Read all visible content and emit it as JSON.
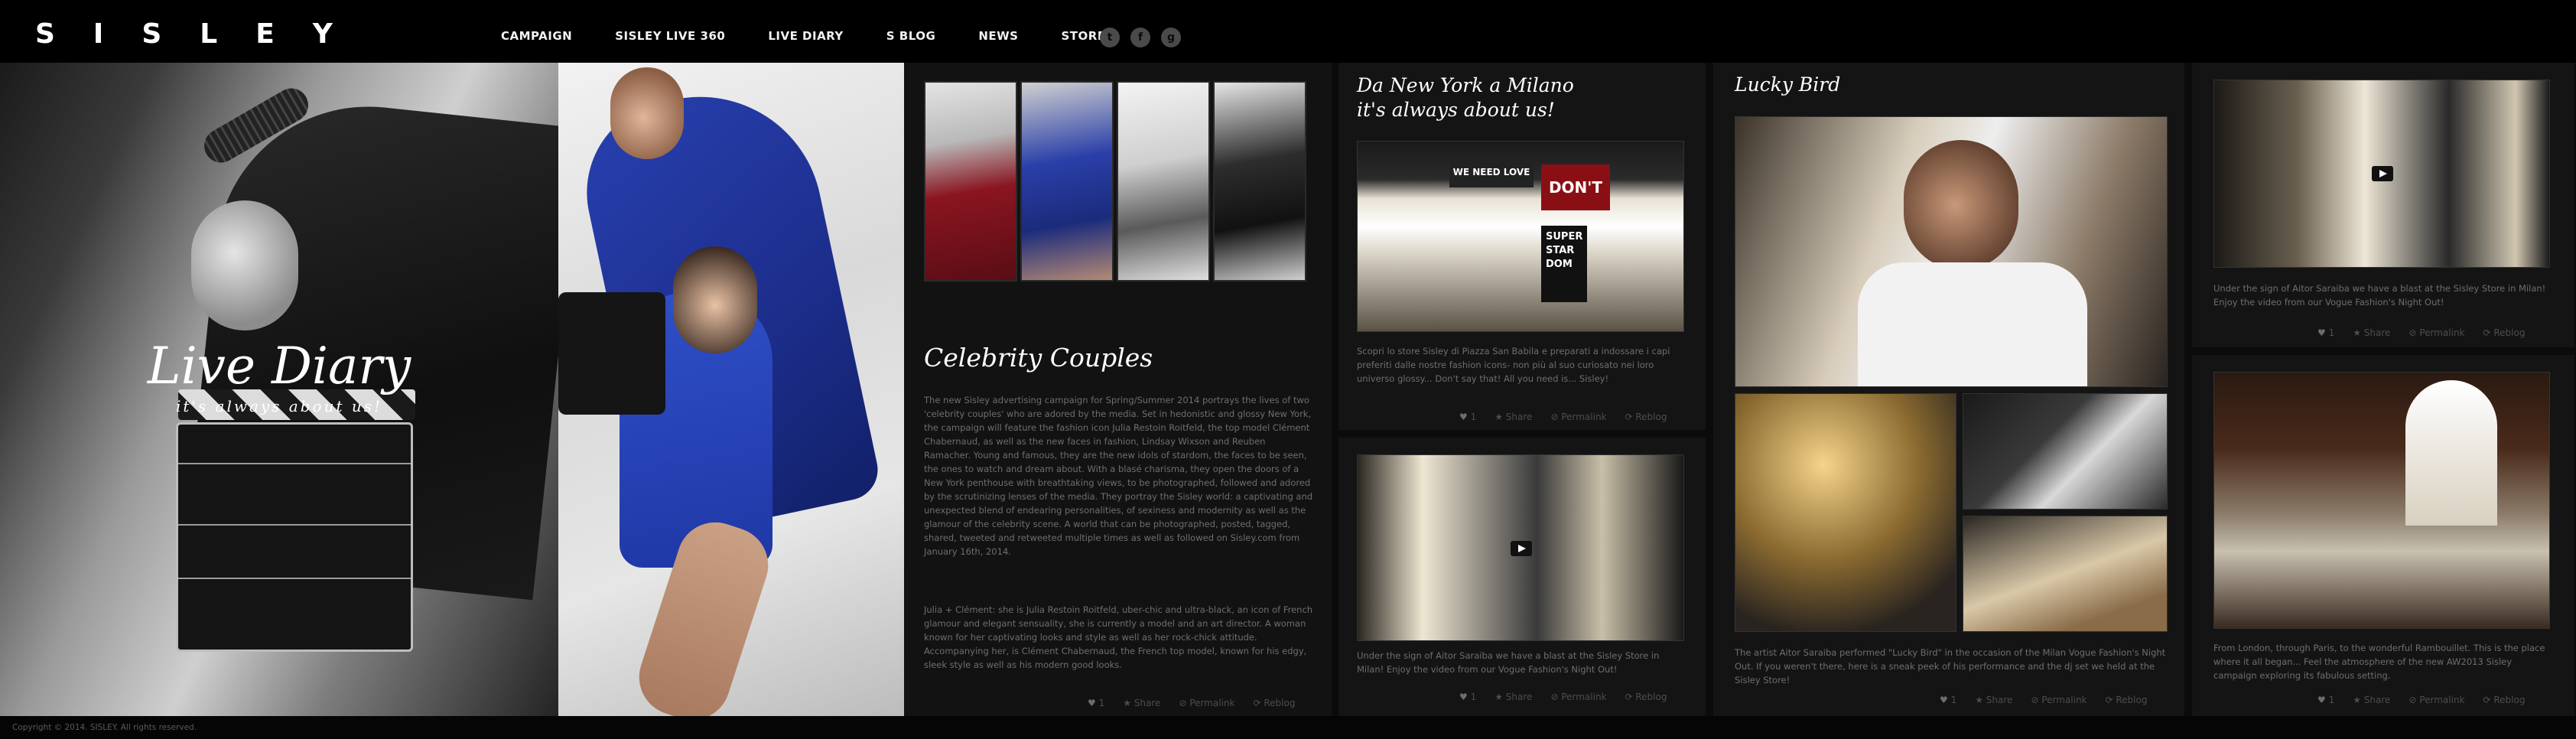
{
  "brand": {
    "logo": "SISLEY"
  },
  "nav": [
    "CAMPAIGN",
    "SISLEY LIVE 360",
    "LIVE DIARY",
    "S BLOG",
    "NEWS",
    "STORES"
  ],
  "social": [
    {
      "name": "twitter",
      "glyph": "t"
    },
    {
      "name": "facebook",
      "glyph": "f"
    },
    {
      "name": "google-plus",
      "glyph": "g"
    }
  ],
  "hero": {
    "title": "Live Diary",
    "subtitle": "it's always about us!"
  },
  "celebrity": {
    "title": "Celebrity Couples",
    "p1": "The new Sisley advertising campaign for Spring/Summer 2014 portrays the lives of two 'celebrity couples' who are adored by the media. Set in hedonistic and glossy New York, the campaign will feature the fashion icon Julia Restoin Roitfeld, the top model Clément Chabernaud, as well as the new faces in fashion, Lindsay Wixson and Reuben Ramacher. Young and famous, they are the new idols of stardom, the faces to be seen, the ones to watch and dream about. With a blasé charisma, they open the doors of a New York penthouse with breathtaking views, to be photographed, followed and adored by the scrutinizing lenses of the media. They portray the Sisley world: a captivating and unexpected blend of endearing personalities, of sexiness and modernity as well as the glamour of the celebrity scene. A world that can be photographed, posted, tagged, shared, tweeted and retweeted multiple times as well as followed on Sisley.com from January 16th, 2014.",
    "p2": "Julia + Clément: she is Julia Restoin Roitfeld, uber-chic and ultra-black, an icon of French glamour and elegant sensuality, she is currently a model and an art director. A woman known for her captivating looks and style as well as her rock-chick attitude. Accompanying her, is Clément Chabernaud, the French top model, known for his edgy, sleek style as well as his modern good looks.",
    "likes": "1"
  },
  "milano": {
    "title_line1": "Da New York a Milano",
    "title_line2": "it's always about us!",
    "text": "Scopri lo store Sisley di Piazza San Babila e preparati a indossare i capi preferiti dalle nostre fashion icons- non più al suo curiosato nei loro universo glossy... Don't say that! All you need is... Sisley!",
    "store_sign_1": "WE NEED LOVE",
    "store_sign_2": "DON'T",
    "store_sign_3": "SUPER STAR DOM",
    "likes": "1"
  },
  "video1": {
    "text": "Under the sign of Aitor Saraiba we have a blast at the Sisley Store in Milan! Enjoy the video from our Vogue Fashion's Night Out!",
    "likes": "1"
  },
  "lucky": {
    "title": "Lucky Bird",
    "text": "The artist Aitor Saraiba performed \"Lucky Bird\" in the occasion of the Milan Vogue Fashion's Night Out. If you weren't there, here is a sneak peek of his performance and the dj set we held at the Sisley Store!",
    "likes": "1"
  },
  "video2": {
    "text": "Under the sign of Aitor Saraiba we have a blast at the Sisley Store in Milan! Enjoy the video from our Vogue Fashion's Night Out!",
    "likes": "1"
  },
  "paris": {
    "text": "From London, through Paris, to the wonderful Rambouillet. This is the place where it all began... Feel the atmosphere of the new AW2013 Sisley campaign exploring its fabulous setting.",
    "likes": "1"
  },
  "actions": {
    "share": "Share",
    "permalink": "Permalink",
    "reblog": "Reblog"
  },
  "footer": {
    "copyright": "Copyright © 2014. SISLEY. All rights reserved."
  }
}
